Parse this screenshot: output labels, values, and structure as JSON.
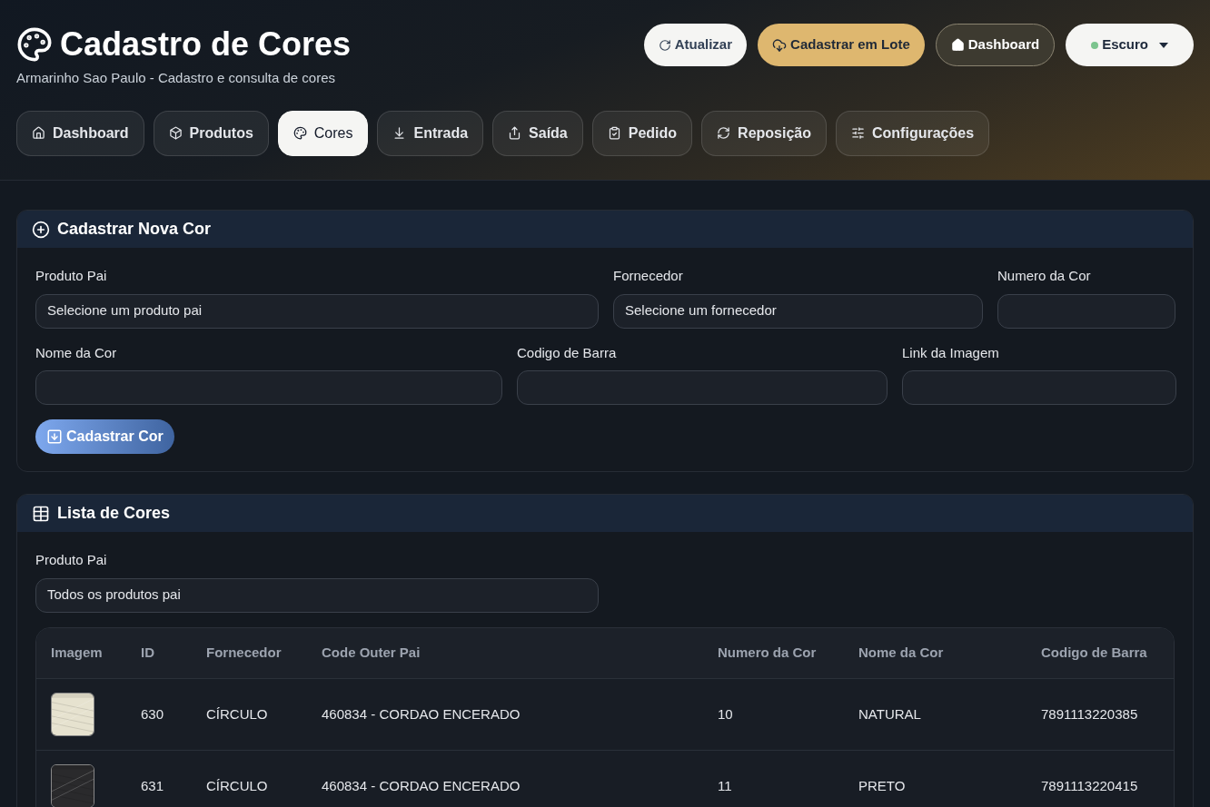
{
  "header": {
    "title": "Cadastro de Cores",
    "subtitle": "Armarinho Sao Paulo - Cadastro e consulta de cores",
    "actions": [
      {
        "label": "Atualizar",
        "kind": "light"
      },
      {
        "label": "Cadastrar em Lote",
        "kind": "accent"
      },
      {
        "label": "Dashboard",
        "kind": "outline"
      },
      {
        "label": "Escuro",
        "kind": "select",
        "color": "#7cc48e"
      }
    ]
  },
  "tabs": [
    {
      "label": "Dashboard",
      "selected": false
    },
    {
      "label": "Produtos",
      "selected": false
    },
    {
      "label": "Cores",
      "selected": true
    },
    {
      "label": "Entrada",
      "selected": false
    },
    {
      "label": "Saída",
      "selected": false
    },
    {
      "label": "Pedido",
      "selected": false
    },
    {
      "label": "Reposição",
      "selected": false
    },
    {
      "label": "Configurações",
      "selected": false
    }
  ],
  "new_color": {
    "title": "Cadastrar Nova Cor",
    "fields": [
      {
        "label": "Produto Pai",
        "kind": "select",
        "value": "Selecione um produto pai"
      },
      {
        "label": "Fornecedor",
        "kind": "select",
        "value": "Selecione um fornecedor"
      },
      {
        "label": "Numero da Cor",
        "kind": "text"
      },
      {
        "label": "Nome da Cor",
        "kind": "text"
      },
      {
        "label": "Codigo de Barra",
        "kind": "text"
      },
      {
        "label": "Link da Imagem",
        "kind": "text"
      }
    ],
    "submit": "Cadastrar Cor"
  },
  "color_list": {
    "title": "Lista de Cores",
    "filter": {
      "label": "Produto Pai",
      "value": "Todos os produtos pai"
    },
    "table": {
      "columns": [
        "Imagem",
        "ID",
        "Fornecedor",
        "Code Outer Pai",
        "Numero da Cor",
        "Nome da Cor",
        "Codigo de Barra"
      ],
      "rows": [
        {
          "cells": [
            {
              "kind": "picture",
              "color": "#e6e2cf"
            },
            "630",
            "CÍRCULO",
            "460834 - CORDAO ENCERADO",
            "10",
            "NATURAL",
            "7891113220385"
          ]
        },
        {
          "cells": [
            {
              "kind": "picture",
              "color": "#2a2a2c"
            },
            "631",
            "CÍRCULO",
            "460834 - CORDAO ENCERADO",
            "11",
            "PRETO",
            "7891113220415"
          ]
        }
      ]
    }
  }
}
